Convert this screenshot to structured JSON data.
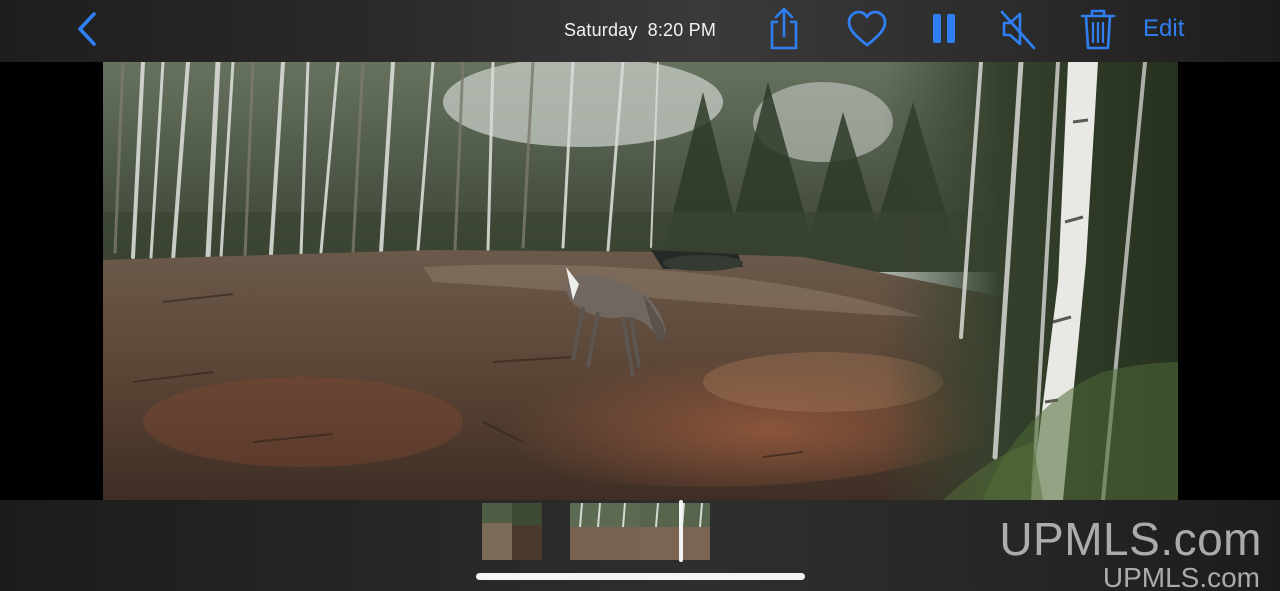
{
  "toolbar": {
    "back_icon": "chevron-left-icon",
    "date_day": "Saturday",
    "date_time": "8:20 PM",
    "share_icon": "share-icon",
    "favorite_icon": "heart-icon",
    "pause_icon": "pause-icon",
    "mute_icon": "speaker-muted-icon",
    "delete_icon": "trash-icon",
    "edit_label": "Edit",
    "accent_color": "#2f7ff2"
  },
  "video": {
    "content": "trail-camera-video-frame",
    "state": "playing",
    "audio": "muted"
  },
  "scrubber": {
    "thumbnail_count": 4,
    "progress": 0.79
  },
  "watermark": {
    "line1": "UPMLS.com",
    "line2": "UPMLS.com"
  }
}
